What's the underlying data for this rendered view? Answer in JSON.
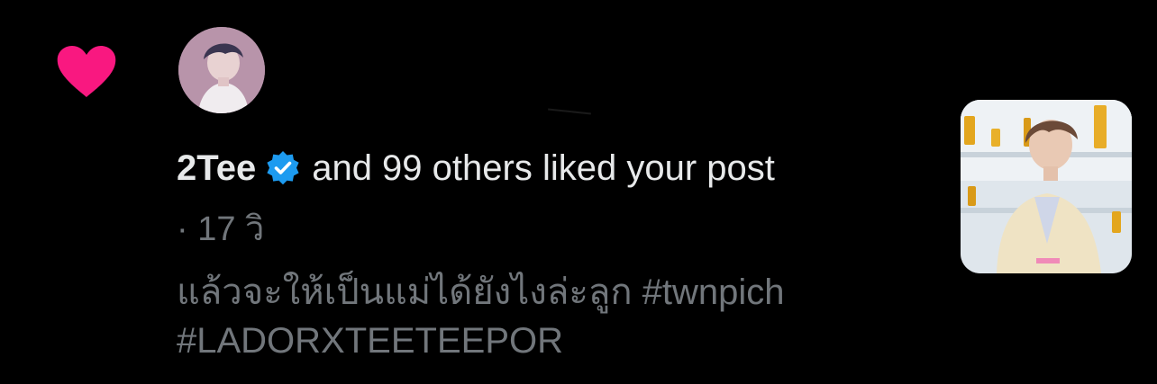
{
  "notification": {
    "username": "2Tee",
    "action_text": "and 99 others liked your post",
    "timestamp": "· 17 วิ",
    "post_line1": "แล้วจะให้เป็นแม่ได้ยังไงล่ะลูก  #twnpich",
    "post_line2": "#LADORXTEETEEPOR"
  },
  "colors": {
    "background": "#000000",
    "heart": "#f91880",
    "verified": "#1d9bf0",
    "primary_text": "#e7e9ea",
    "secondary_text": "#71767b"
  },
  "icons": {
    "like": "heart-icon",
    "verified": "verified-badge-icon"
  }
}
